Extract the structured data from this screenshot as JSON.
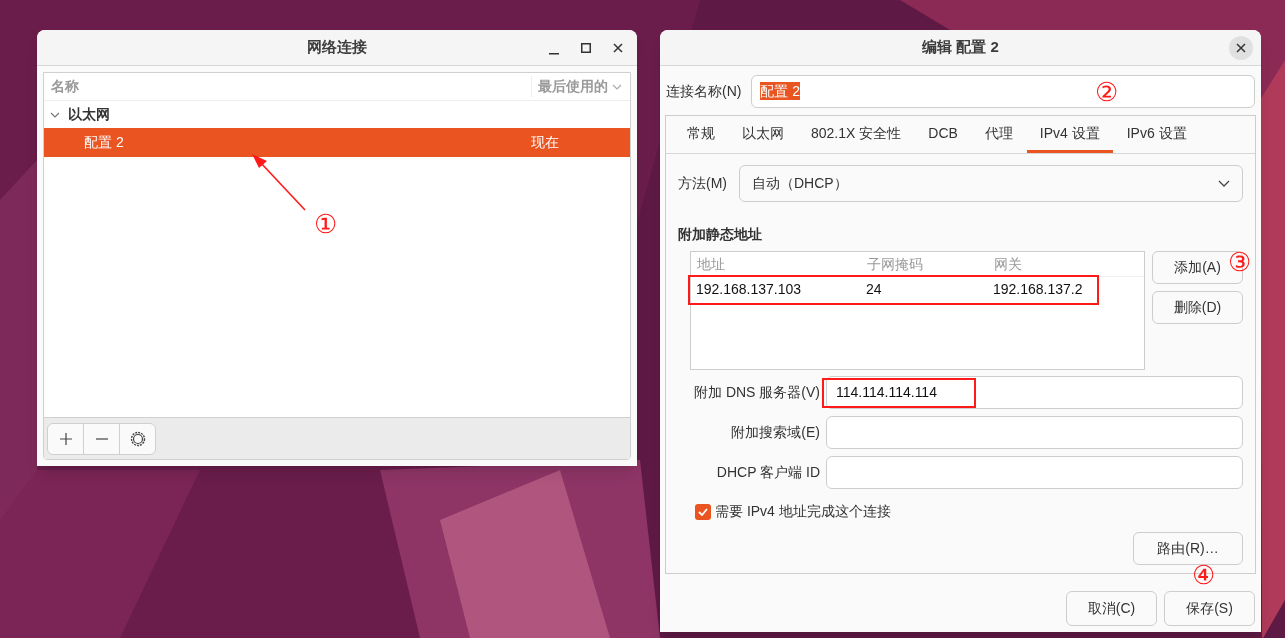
{
  "connections_window": {
    "title": "网络连接",
    "columns": [
      "名称",
      "最后使用的"
    ],
    "groups": [
      {
        "label": "以太网",
        "expanded": true,
        "items": [
          {
            "name": "配置 2",
            "last_used": "现在",
            "selected": true
          }
        ]
      }
    ]
  },
  "edit_window": {
    "title": "编辑 配置 2",
    "name_label": "连接名称(N)",
    "name_value": "配置 2",
    "tabs": [
      {
        "label": "常规",
        "selected": false
      },
      {
        "label": "以太网",
        "selected": false
      },
      {
        "label": "802.1X 安全性",
        "selected": false
      },
      {
        "label": "DCB",
        "selected": false
      },
      {
        "label": "代理",
        "selected": false
      },
      {
        "label": "IPv4 设置",
        "selected": true
      },
      {
        "label": "IPv6 设置",
        "selected": false
      }
    ],
    "method_label": "方法(M)",
    "method_value": "自动（DHCP）",
    "section_title": "附加静态地址",
    "table": {
      "columns": [
        "地址",
        "子网掩码",
        "网关"
      ],
      "rows": [
        [
          "192.168.137.103",
          "24",
          "192.168.137.2"
        ]
      ]
    },
    "table_buttons": [
      "添加(A)",
      "删除(D)"
    ],
    "fields": [
      {
        "label": "附加 DNS 服务器(V)",
        "value": "114.114.114.114"
      },
      {
        "label": "附加搜索域(E)"
      },
      {
        "label": "DHCP 客户端 ID"
      }
    ],
    "require_ipv4": {
      "label": "需要 IPv4 地址完成这个连接",
      "checked": true
    },
    "routes_button": "路由(R)…",
    "buttons": [
      "取消(C)",
      "保存(S)"
    ]
  },
  "annotations": [
    "①",
    "②",
    "③",
    "④"
  ]
}
